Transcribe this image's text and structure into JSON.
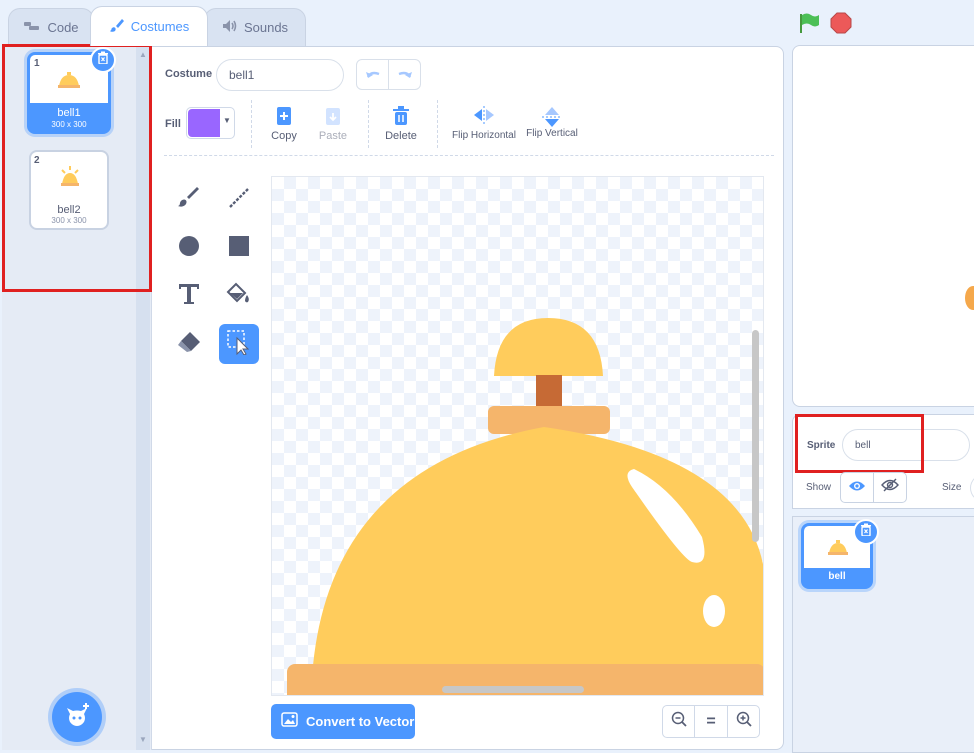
{
  "tabs": {
    "code": "Code",
    "costumes": "Costumes",
    "sounds": "Sounds"
  },
  "costume_list": [
    {
      "index": "1",
      "name": "bell1",
      "size": "300 x 300",
      "selected": true
    },
    {
      "index": "2",
      "name": "bell2",
      "size": "300 x 300",
      "selected": false
    }
  ],
  "editor": {
    "costume_label": "Costume",
    "costume_name": "bell1",
    "fill_label": "Fill",
    "fill_color": "#9966ff",
    "copy": "Copy",
    "paste": "Paste",
    "delete": "Delete",
    "flip_horizontal": "Flip Horizontal",
    "flip_vertical": "Flip Vertical",
    "convert_button": "Convert to Vector",
    "zoom_reset": "="
  },
  "sprite_info": {
    "sprite_label": "Sprite",
    "sprite_name": "bell",
    "show_label": "Show",
    "size_label": "Size"
  },
  "sprite_list": [
    {
      "name": "bell",
      "selected": true
    }
  ],
  "colors": {
    "accent": "#4c97ff",
    "highlight_box": "#e02020",
    "bell_yellow": "#ffcc5c",
    "bell_base": "#f5b56b",
    "bell_stem": "#c66a35",
    "green_flag": "#4cbf56",
    "stop": "#ec5959"
  }
}
